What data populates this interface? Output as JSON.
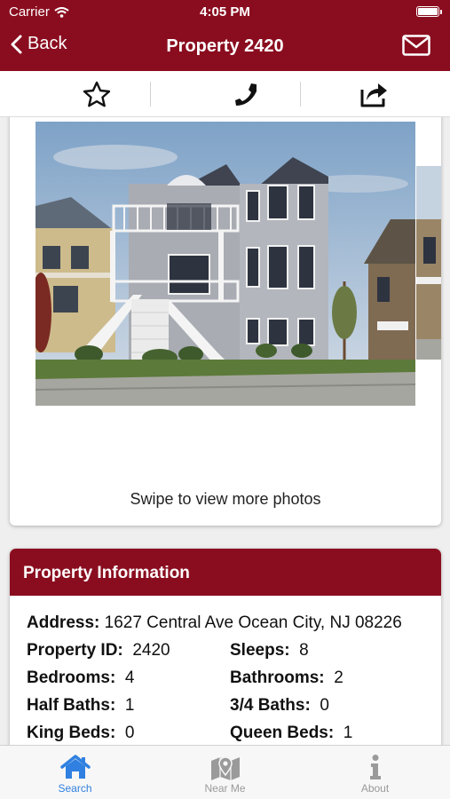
{
  "status_bar": {
    "carrier": "Carrier",
    "time": "4:05 PM"
  },
  "nav": {
    "back_label": "Back",
    "title": "Property 2420",
    "mail_icon": "envelope-icon"
  },
  "actions": [
    {
      "name": "favorite",
      "icon": "star-outline-icon"
    },
    {
      "name": "call",
      "icon": "phone-icon"
    },
    {
      "name": "share",
      "icon": "share-icon"
    }
  ],
  "gallery": {
    "swipe_hint": "Swipe to view more photos"
  },
  "property_info": {
    "header": "Property Information",
    "address_label": "Address:",
    "address_value": "1627 Central Ave Ocean City, NJ 08226",
    "rows": [
      [
        {
          "label": "Property ID:",
          "value": "2420"
        },
        {
          "label": "Sleeps:",
          "value": "8"
        }
      ],
      [
        {
          "label": "Bedrooms:",
          "value": "4"
        },
        {
          "label": "Bathrooms:",
          "value": "2"
        }
      ],
      [
        {
          "label": "Half Baths:",
          "value": "1"
        },
        {
          "label": "3/4 Baths:",
          "value": "0"
        }
      ],
      [
        {
          "label": "King Beds:",
          "value": "0"
        },
        {
          "label": "Queen Beds:",
          "value": "1"
        }
      ]
    ]
  },
  "tabs": [
    {
      "label": "Search",
      "icon": "house-icon",
      "active": true
    },
    {
      "label": "Near Me",
      "icon": "map-pin-icon",
      "active": false
    },
    {
      "label": "About",
      "icon": "info-icon",
      "active": false
    }
  ],
  "colors": {
    "brand": "#8a0d1f",
    "tab_active": "#2f80e0",
    "tab_inactive": "#9a9a9a"
  }
}
